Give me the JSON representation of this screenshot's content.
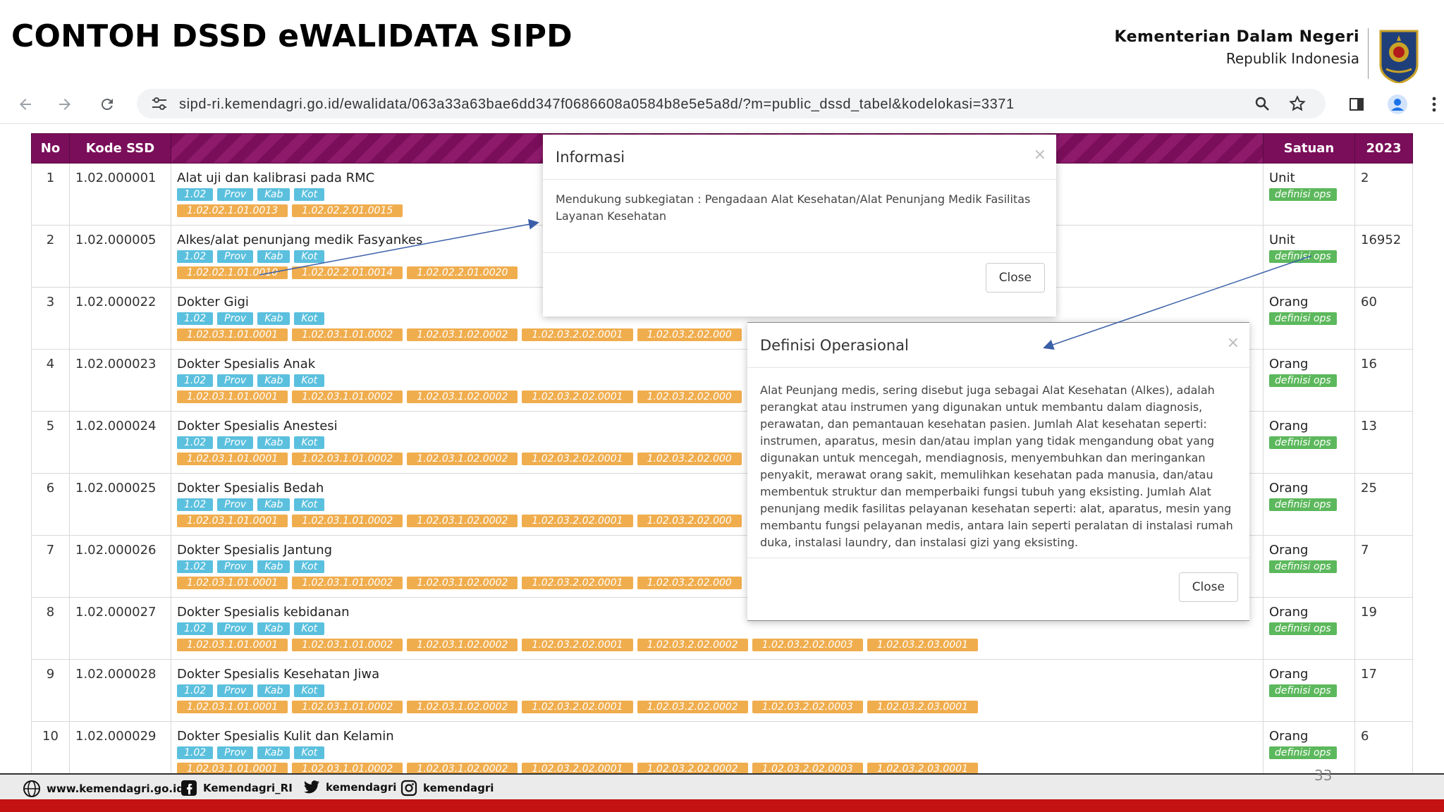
{
  "slide": {
    "title": "CONTOH DSSD eWALIDATA SIPD",
    "ministry_line1": "Kementerian Dalam Negeri",
    "ministry_line2": "Republik Indonesia",
    "page_number": "33"
  },
  "browser": {
    "url": "sipd-ri.kemendagri.go.id/ewalidata/063a33a63bae6dd347f0686608a0584b8e5e5a8d/?m=public_dssd_tabel&kodelokasi=3371"
  },
  "table": {
    "headers": {
      "no": "No",
      "kode": "Kode SSD",
      "satuan": "Satuan",
      "year": "2023"
    },
    "blue_tags": [
      "1.02",
      "Prov",
      "Kab",
      "Kot"
    ],
    "def_tag": "definisi ops",
    "rows": [
      {
        "no": "1",
        "kode": "1.02.000001",
        "name": "Alat uji dan kalibrasi pada RMC",
        "codes": [
          "1.02.02.1.01.0013",
          "1.02.02.2.01.0015"
        ],
        "satuan": "Unit",
        "value": "2"
      },
      {
        "no": "2",
        "kode": "1.02.000005",
        "name": "Alkes/alat penunjang medik Fasyankes",
        "codes": [
          "1.02.02.1.01.0010",
          "1.02.02.2.01.0014",
          "1.02.02.2.01.0020"
        ],
        "satuan": "Unit",
        "value": "16952"
      },
      {
        "no": "3",
        "kode": "1.02.000022",
        "name": "Dokter Gigi",
        "codes": [
          "1.02.03.1.01.0001",
          "1.02.03.1.01.0002",
          "1.02.03.1.02.0002",
          "1.02.03.2.02.0001",
          "1.02.03.2.02.000"
        ],
        "satuan": "Orang",
        "value": "60"
      },
      {
        "no": "4",
        "kode": "1.02.000023",
        "name": "Dokter Spesialis Anak",
        "codes": [
          "1.02.03.1.01.0001",
          "1.02.03.1.01.0002",
          "1.02.03.1.02.0002",
          "1.02.03.2.02.0001",
          "1.02.03.2.02.000"
        ],
        "satuan": "Orang",
        "value": "16"
      },
      {
        "no": "5",
        "kode": "1.02.000024",
        "name": "Dokter Spesialis Anestesi",
        "codes": [
          "1.02.03.1.01.0001",
          "1.02.03.1.01.0002",
          "1.02.03.1.02.0002",
          "1.02.03.2.02.0001",
          "1.02.03.2.02.000"
        ],
        "satuan": "Orang",
        "value": "13"
      },
      {
        "no": "6",
        "kode": "1.02.000025",
        "name": "Dokter Spesialis Bedah",
        "codes": [
          "1.02.03.1.01.0001",
          "1.02.03.1.01.0002",
          "1.02.03.1.02.0002",
          "1.02.03.2.02.0001",
          "1.02.03.2.02.000"
        ],
        "satuan": "Orang",
        "value": "25"
      },
      {
        "no": "7",
        "kode": "1.02.000026",
        "name": "Dokter Spesialis Jantung",
        "codes": [
          "1.02.03.1.01.0001",
          "1.02.03.1.01.0002",
          "1.02.03.1.02.0002",
          "1.02.03.2.02.0001",
          "1.02.03.2.02.000"
        ],
        "satuan": "Orang",
        "value": "7"
      },
      {
        "no": "8",
        "kode": "1.02.000027",
        "name": "Dokter Spesialis kebidanan",
        "codes": [
          "1.02.03.1.01.0001",
          "1.02.03.1.01.0002",
          "1.02.03.1.02.0002",
          "1.02.03.2.02.0001",
          "1.02.03.2.02.0002",
          "1.02.03.2.02.0003",
          "1.02.03.2.03.0001"
        ],
        "satuan": "Orang",
        "value": "19"
      },
      {
        "no": "9",
        "kode": "1.02.000028",
        "name": "Dokter Spesialis Kesehatan Jiwa",
        "codes": [
          "1.02.03.1.01.0001",
          "1.02.03.1.01.0002",
          "1.02.03.1.02.0002",
          "1.02.03.2.02.0001",
          "1.02.03.2.02.0002",
          "1.02.03.2.02.0003",
          "1.02.03.2.03.0001"
        ],
        "satuan": "Orang",
        "value": "17"
      },
      {
        "no": "10",
        "kode": "1.02.000029",
        "name": "Dokter Spesialis Kulit dan Kelamin",
        "codes": [
          "1.02.03.1.01.0001",
          "1.02.03.1.01.0002",
          "1.02.03.1.02.0002",
          "1.02.03.2.02.0001",
          "1.02.03.2.02.0002",
          "1.02.03.2.02.0003",
          "1.02.03.2.03.0001"
        ],
        "satuan": "Orang",
        "value": "6"
      }
    ]
  },
  "modal_info": {
    "title": "Informasi",
    "close_x": "×",
    "body": "Mendukung subkegiatan : Pengadaan Alat Kesehatan/Alat Penunjang Medik Fasilitas Layanan Kesehatan",
    "close_label": "Close"
  },
  "modal_def": {
    "title": "Definisi Operasional",
    "close_x": "×",
    "body": "Alat Peunjang medis, sering disebut juga sebagai Alat Kesehatan (Alkes), adalah perangkat atau instrumen yang digunakan untuk membantu dalam diagnosis, perawatan, dan pemantauan kesehatan pasien. Jumlah Alat kesehatan seperti: instrumen, aparatus, mesin dan/atau implan yang tidak mengandung obat yang digunakan untuk mencegah, mendiagnosis, menyembuhkan dan meringankan penyakit, merawat orang sakit, memulihkan kesehatan pada manusia, dan/atau membentuk struktur dan memperbaiki fungsi tubuh yang eksisting. Jumlah Alat penunjang medik fasilitas pelayanan kesehatan seperti: alat, aparatus, mesin yang membantu fungsi pelayanan medis, antara lain seperti peralatan di instalasi rumah duka, instalasi laundry, dan instalasi gizi yang eksisting.",
    "close_label": "Close"
  },
  "footer": {
    "website": "www.kemendagri.go.id",
    "facebook": "Kemendagri_RI",
    "twitter": "kemendagri",
    "instagram": "kemendagri"
  },
  "colors": {
    "header_purple": "#7a0e5a",
    "tag_blue": "#5bc0de",
    "tag_orange": "#f0ad4e",
    "tag_green": "#5cb85c",
    "footer_red": "#c41212"
  }
}
